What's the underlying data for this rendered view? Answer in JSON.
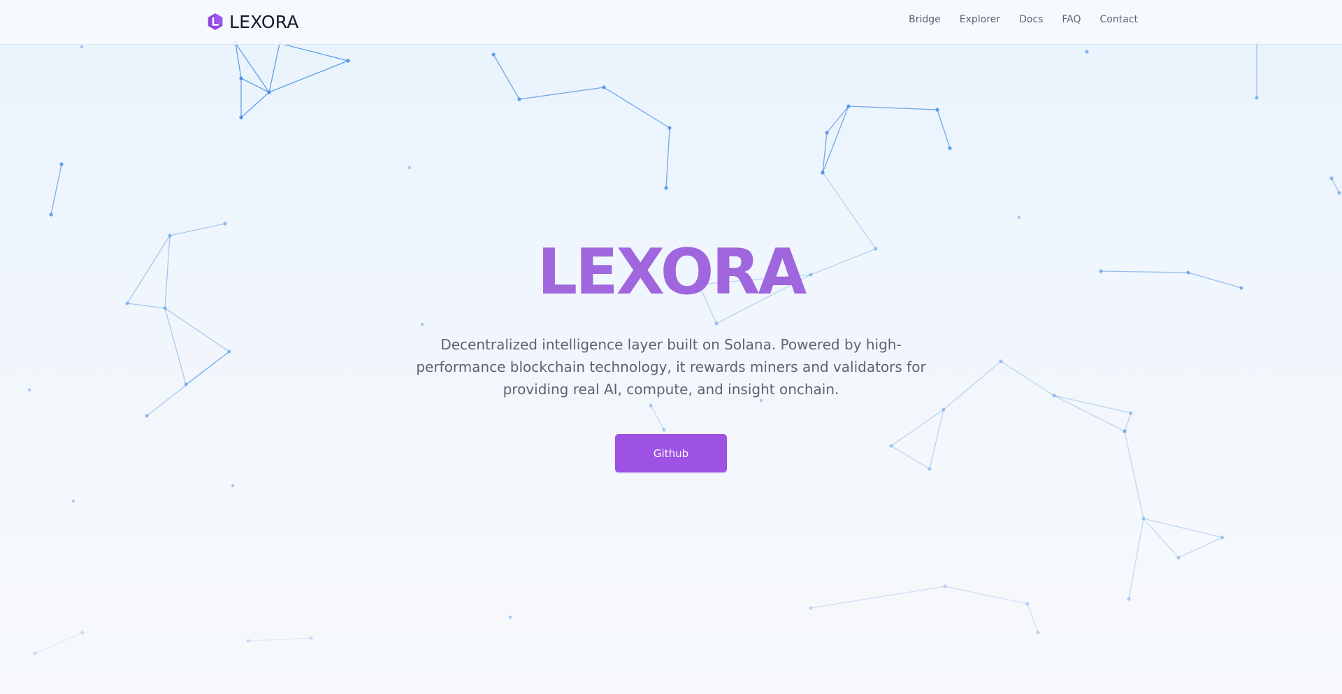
{
  "navbar": {
    "brand_name": "LEXORA",
    "links": [
      {
        "label": "Bridge"
      },
      {
        "label": "Explorer"
      },
      {
        "label": "Docs"
      },
      {
        "label": "FAQ"
      },
      {
        "label": "Contact"
      }
    ]
  },
  "hero": {
    "title": "LEXORA",
    "subtitle": "Decentralized intelligence layer built on Solana. Powered by high-performance blockchain technology, it rewards miners and validators for providing real AI, compute, and insight onchain.",
    "button_label": "Github"
  },
  "colors": {
    "accent": "#9d52e3",
    "title": "#a066dd",
    "network_lines": "#4a90e2",
    "background": "#eef5fd"
  },
  "icons": {
    "brand_logo": "hexagon-logo-icon"
  }
}
